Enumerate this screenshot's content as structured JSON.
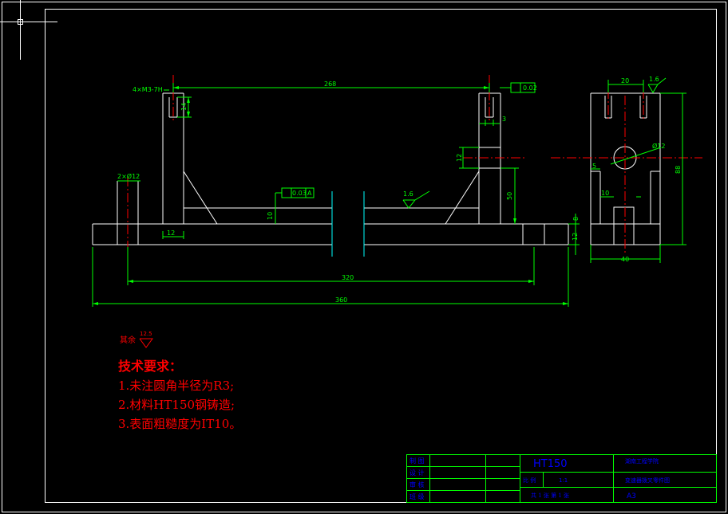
{
  "colors": {
    "background": "#000000",
    "outline": "#ffffff",
    "dimension": "#00ff00",
    "centerline": "#ff0000",
    "section": "#00ffff",
    "notes": "#ff0000",
    "titleblock": "#0000ff"
  },
  "front_view": {
    "hole_label": "4×M3-7H",
    "dim_top": "268",
    "tolerance_value": "0.02",
    "dim_14": "14",
    "dim_3": "3",
    "dim_12_right": "12",
    "dim_50": "50",
    "dim_12_bottom": "12",
    "dim_8": "8",
    "dim_10": "10",
    "pin_label": "2×Ø12",
    "flatness_value": "0.03",
    "datum": "A",
    "roughness": "1.6",
    "dim_320": "320",
    "dim_360": "360"
  },
  "side_view": {
    "dim_20": "20",
    "roughness": "1.6",
    "dim_88": "88",
    "bore": "Ø12",
    "dim_5": "5",
    "dim_10": "10",
    "dim_40": "40"
  },
  "notes": {
    "rest_label": "其余",
    "rest_value": "12.5",
    "title": "技术要求：",
    "items": [
      "1.未注圆角半径为R3;",
      "2.材料HT150钢铸造;",
      "3.表面粗糙度为IT10。"
    ]
  },
  "titleblock": {
    "material": "HT150",
    "school": "湖南工程学院",
    "drawing_name": "变速器拨叉零件图",
    "scale_label": "比 例",
    "scale": "1:1",
    "sheet": "A3",
    "bottom_row": "共 1 张  第 1 张",
    "rows": [
      "制 图",
      "设 计",
      "审 核",
      "班 级"
    ]
  }
}
